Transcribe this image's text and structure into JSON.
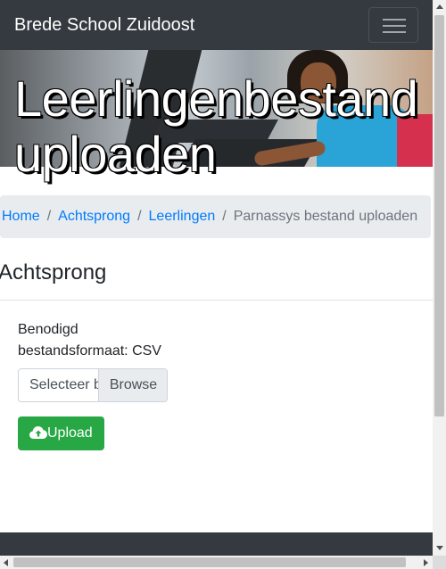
{
  "navbar": {
    "brand": "Brede School Zuidoost",
    "toggler_icon": "hamburger-menu-icon"
  },
  "hero": {
    "title_line1": "Leerlingenbestand",
    "title_line2": "uploaden"
  },
  "breadcrumb": {
    "items": [
      "Home",
      "Achtsprong",
      "Leerlingen"
    ],
    "active": "Parnassys bestand uploaden",
    "separator": "/"
  },
  "section": {
    "title": "Achtsprong"
  },
  "form": {
    "format_line1": "Benodigd",
    "format_line2": "bestandsformaat: CSV",
    "file_placeholder": "Selecteer bestand",
    "browse_label": "Browse",
    "upload_label": "Upload",
    "upload_icon": "cloud-upload-icon"
  },
  "colors": {
    "navbar": "#343a40",
    "link": "#007bff",
    "upload_button": "#28a745",
    "breadcrumb_bg": "#e9ecef"
  }
}
